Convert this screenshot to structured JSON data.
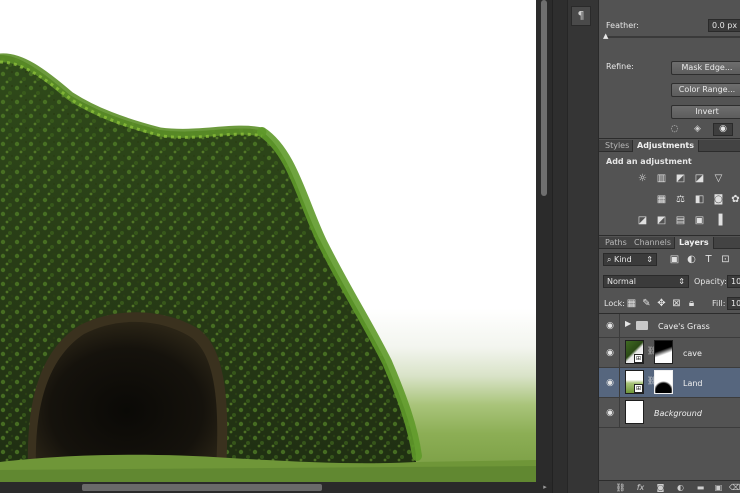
{
  "properties": {
    "feather_label": "Feather:",
    "feather_value": "0.0 px",
    "feather_slider": 0.0,
    "refine_label": "Refine:",
    "mask_edge_label": "Mask Edge...",
    "color_range_label": "Color Range...",
    "invert_label": "Invert"
  },
  "adjustments": {
    "tabs": [
      "Styles",
      "Adjustments"
    ],
    "active_tab": "Adjustments",
    "heading": "Add an adjustment"
  },
  "layers": {
    "tabs": [
      "Paths",
      "Channels",
      "Layers"
    ],
    "active_tab": "Layers",
    "filter_kind": "Kind",
    "blend_mode": "Normal",
    "opacity_label": "Opacity:",
    "opacity_value": "10",
    "lock_label": "Lock:",
    "fill_label": "Fill:",
    "fill_value": "10",
    "items": [
      {
        "name": "Cave's Grass",
        "type": "group"
      },
      {
        "name": "cave",
        "type": "masked"
      },
      {
        "name": "Land",
        "type": "masked",
        "selected": true
      },
      {
        "name": "Background",
        "type": "background"
      }
    ]
  },
  "strip": {
    "paragraph_icon": "¶"
  },
  "icons": {
    "fx": "fx",
    "accent_selected": "#56667e"
  }
}
